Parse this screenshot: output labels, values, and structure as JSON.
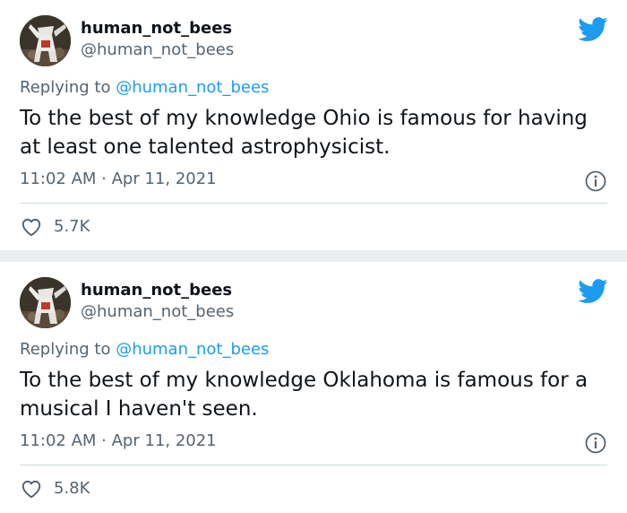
{
  "tweets": [
    {
      "display_name": "human_not_bees",
      "handle": "@human_not_bees",
      "replying_prefix": "Replying to ",
      "replying_to": "@human_not_bees",
      "text": "To the best of my knowledge Ohio is famous for having at least one talented astrophysicist.",
      "timestamp": "11:02 AM · Apr 11, 2021",
      "likes": "5.7K"
    },
    {
      "display_name": "human_not_bees",
      "handle": "@human_not_bees",
      "replying_prefix": "Replying to ",
      "replying_to": "@human_not_bees",
      "text": "To the best of my knowledge Oklahoma is famous for a musical I haven't seen.",
      "timestamp": "11:02 AM · Apr 11, 2021",
      "likes": "5.8K"
    }
  ],
  "colors": {
    "twitter_blue": "#1d9bf0",
    "secondary_text": "#536471",
    "primary_text": "#0f1419",
    "divider": "#cfd9de",
    "background_gap": "#ebeef0"
  },
  "icons": {
    "brand": "twitter-bird-icon",
    "info": "info-icon",
    "like": "heart-icon",
    "avatar": "avatar"
  }
}
